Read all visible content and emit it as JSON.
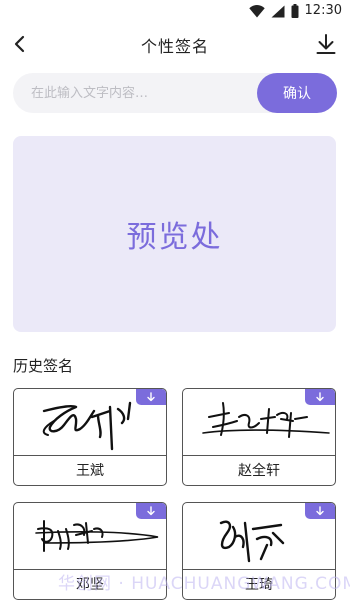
{
  "status_bar": {
    "time": "12:30",
    "icons": [
      "wifi-icon",
      "signal-icon",
      "battery-icon"
    ]
  },
  "header": {
    "title": "个性签名",
    "back_icon": "back-icon",
    "download_icon": "download-icon"
  },
  "input": {
    "placeholder": "在此输入文字内容…",
    "value": "",
    "confirm_label": "确认"
  },
  "preview": {
    "label": "预览处"
  },
  "history": {
    "title": "历史签名",
    "items": [
      {
        "name": "王斌"
      },
      {
        "name": "赵全轩"
      },
      {
        "name": "邓坚"
      },
      {
        "name": "王琦"
      }
    ]
  },
  "watermark": "华创网 · HUACHUANGWANG.COM",
  "colors": {
    "accent": "#7b6cdc",
    "preview_bg": "#ebe9f8",
    "input_bg": "#f3f3f6"
  }
}
